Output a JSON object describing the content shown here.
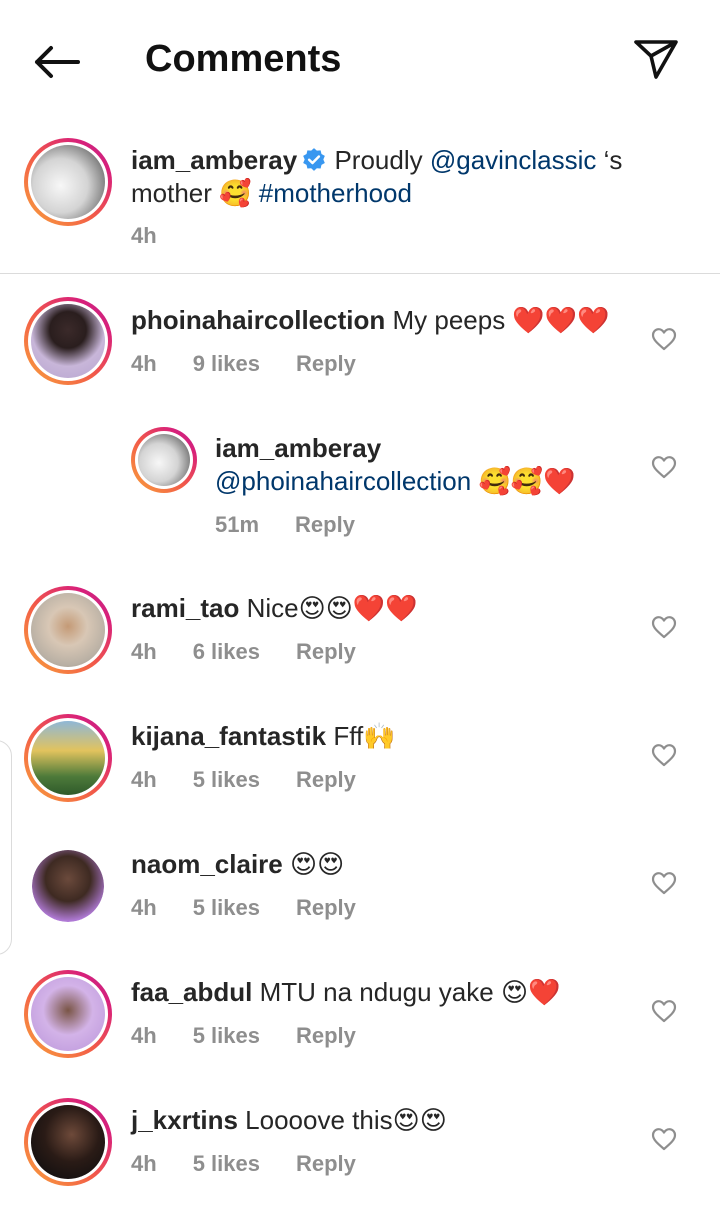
{
  "header": {
    "title": "Comments"
  },
  "caption": {
    "username": "iam_amberay",
    "text_before_mention": " Proudly ",
    "mention": "@gavinclassic",
    "text_after_mention": " ‘s mother 🥰 ",
    "hashtag": "#motherhood",
    "time": "4h"
  },
  "comments": [
    {
      "username": "phoinahaircollection",
      "text": " My peeps ❤️❤️❤️",
      "time": "4h",
      "likes": "9 likes",
      "reply": "Reply"
    },
    {
      "username": "iam_amberay",
      "mention": "@phoinahaircollection",
      "text": " 🥰🥰❤️",
      "time": "51m",
      "reply": "Reply"
    },
    {
      "username": "rami_tao",
      "text": " Nice😍😍❤️❤️",
      "time": "4h",
      "likes": "6 likes",
      "reply": "Reply"
    },
    {
      "username": "kijana_fantastik",
      "text": " Fff🙌",
      "time": "4h",
      "likes": "5 likes",
      "reply": "Reply"
    },
    {
      "username": "naom_claire",
      "text": " 😍😍",
      "time": "4h",
      "likes": "5 likes",
      "reply": "Reply"
    },
    {
      "username": "faa_abdul",
      "text": " MTU na ndugu yake 😍❤️",
      "time": "4h",
      "likes": "5 likes",
      "reply": "Reply"
    },
    {
      "username": "j_kxrtins",
      "text": " Loooove this😍😍",
      "time": "4h",
      "likes": "5 likes",
      "reply": "Reply"
    }
  ],
  "colors": {
    "link": "#00376b",
    "meta": "#8e8e8e",
    "verified": "#3897f0"
  }
}
